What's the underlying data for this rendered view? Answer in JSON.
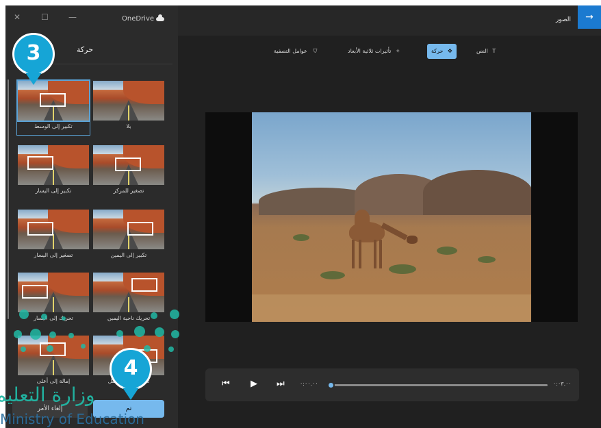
{
  "window": {
    "title": "OneDrive",
    "controls": {
      "close": "✕",
      "maximize": "☐",
      "minimize": "—"
    }
  },
  "header": {
    "back_label": "الصور",
    "back_icon": "arrow-right-icon"
  },
  "toolbar": {
    "items": [
      {
        "label": "النص",
        "icon": "text-icon",
        "active": false
      },
      {
        "label": "حركة",
        "icon": "motion-icon",
        "active": true
      },
      {
        "label": "تأثيرات ثلاثية الأبعاد",
        "icon": "3d-effects-icon",
        "active": false
      },
      {
        "label": "عوامل التصفية",
        "icon": "filter-icon",
        "active": false
      }
    ]
  },
  "panel": {
    "title": "حركة",
    "tiles": [
      {
        "label": "بلا"
      },
      {
        "label": "تكبير إلى الوسط",
        "selected": true
      },
      {
        "label": "تصغير للمركز"
      },
      {
        "label": "تكبير إلى اليسار"
      },
      {
        "label": "تكبير إلى اليمين"
      },
      {
        "label": "تصغير إلى اليسار"
      },
      {
        "label": "تحريك ناحية اليمين"
      },
      {
        "label": "تحريك إلى اليسار"
      },
      {
        "label": "تحريك إلى الأسفل"
      },
      {
        "label": "إمالة إلى أعلى"
      }
    ],
    "cancel_label": "إلغاء الأمر",
    "done_label": "تم"
  },
  "playback": {
    "prev_icon": "previous-frame-icon",
    "play_icon": "play-icon",
    "next_icon": "next-frame-icon",
    "current_time": "٠:٠٠.٠٠",
    "total_time": "٠:٠٣.٠٠",
    "progress": 0
  },
  "callouts": {
    "step3": "3",
    "step4": "4"
  },
  "watermark": {
    "arabic": "وزارة التعليم",
    "english": "Ministry of Education"
  },
  "colors": {
    "accent": "#76b9ed",
    "back_button": "#1b7ad0",
    "callout": "#16a5d6",
    "watermark": "#21b8a5"
  }
}
